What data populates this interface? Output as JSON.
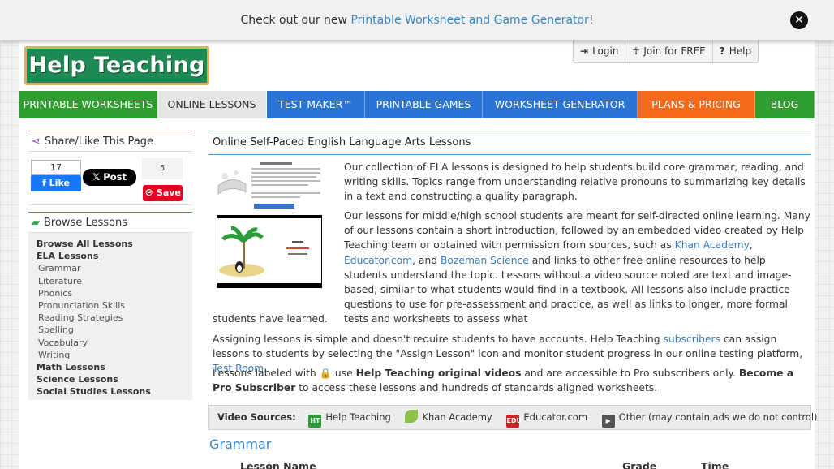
{
  "announcement": {
    "text_before": "Check out our new ",
    "link": "Printable Worksheet and Game Generator",
    "text_after": "!"
  },
  "logo": {
    "text": "Help Teaching"
  },
  "account": {
    "login": "Login",
    "join": "Join for FREE",
    "help": "Help"
  },
  "nav": [
    {
      "label": "PRINTABLE WORKSHEETS",
      "color": "#2e9e2e"
    },
    {
      "label": "ONLINE LESSONS",
      "color": "#e6e6e6"
    },
    {
      "label": "TEST MAKER™",
      "color": "#2a74d6"
    },
    {
      "label": "PRINTABLE GAMES",
      "color": "#2a74d6"
    },
    {
      "label": "WORKSHEET GENERATOR",
      "color": "#2a74d6"
    },
    {
      "label": "PLANS & PRICING",
      "color": "#f46a1a"
    },
    {
      "label": "BLOG",
      "color": "#2e9e2e"
    }
  ],
  "sidebar": {
    "share_title": "Share/Like This Page",
    "fb_count": "17",
    "fb_like": "Like",
    "x_post": "Post",
    "pin_count": "5",
    "pin_save": "Save",
    "browse_title": "Browse Lessons",
    "browse_all": "Browse All Lessons",
    "ela": "ELA Lessons",
    "ela_items": [
      "Grammar",
      "Literature",
      "Phonics",
      "Pronunciation Skills",
      "Reading Strategies",
      "Spelling",
      "Vocabulary",
      "Writing"
    ],
    "math": "Math Lessons",
    "science": "Science Lessons",
    "social": "Social Studies Lessons"
  },
  "main": {
    "title": "Online Self-Paced English Language Arts Lessons",
    "p1": "Our collection of ELA lessons is designed to help students build core grammar, reading, and writing skills. Topics range from understanding relative pronouns to summarizing key details in a text and constructing a quality paragraph.",
    "p2_a": "Our lessons for middle/high school students are meant for self-directed online learning. Many of our lessons contain a short introduction, followed by an embedded video created by Help Teaching team or obtained with permission from sources, such as ",
    "p2_link1": "Khan Academy",
    "p2_sep": ", ",
    "p2_link2": "Educator.com",
    "p2_b": ", and ",
    "p2_link3": "Bozeman Science",
    "p2_c": " and links to other free online resources to help students understand the topic. Lessons without a video source noted are text and image-based, similar to what students would find in a textbook. All lessons also include practice questions to use for pre-assessment and practice, as well as links to longer, more formal tests and worksheets to assess what",
    "p2_tail": "students have learned.",
    "p3_a": "Assigning lessons is simple and doesn't require students to have accounts. Help Teaching ",
    "p3_link1": "subscribers",
    "p3_b": " can assign lessons to students by selecting the \"Assign Lesson\" icon and monitor student progress in our online testing platform, ",
    "p3_link2": "Test Room",
    "p3_c": ".",
    "p4_a": "Lessons labeled with ",
    "p4_b": " use ",
    "p4_bold": "Help Teaching original videos",
    "p4_c": " and are accessible to Pro subscribers only. ",
    "p4_link": "Become a Pro Subscriber",
    "p4_d": " to access these lessons and hundreds of standards aligned worksheets.",
    "video_sources_label": "Video Sources:",
    "video_sources": [
      "Help Teaching",
      "Khan Academy",
      "Educator.com",
      "Other (may contain ads we do not control)"
    ],
    "section_heading": "Grammar",
    "table_headers": [
      "Lesson Name",
      "Grade",
      "Time"
    ]
  }
}
